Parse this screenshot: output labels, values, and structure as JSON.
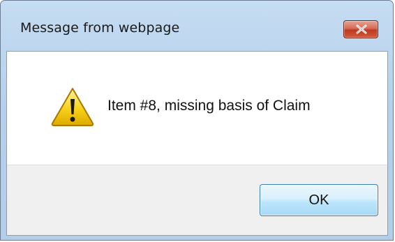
{
  "dialog": {
    "title": "Message from webpage",
    "message": "Item #8, missing basis of Claim",
    "icon": "warning-icon",
    "buttons": {
      "ok_label": "OK"
    },
    "close_icon": "close-icon"
  },
  "colors": {
    "titlebar": "#b8d1eb",
    "close_button": "#c9452b",
    "ok_button": "#bee6fd",
    "footer": "#f0f0f0"
  }
}
